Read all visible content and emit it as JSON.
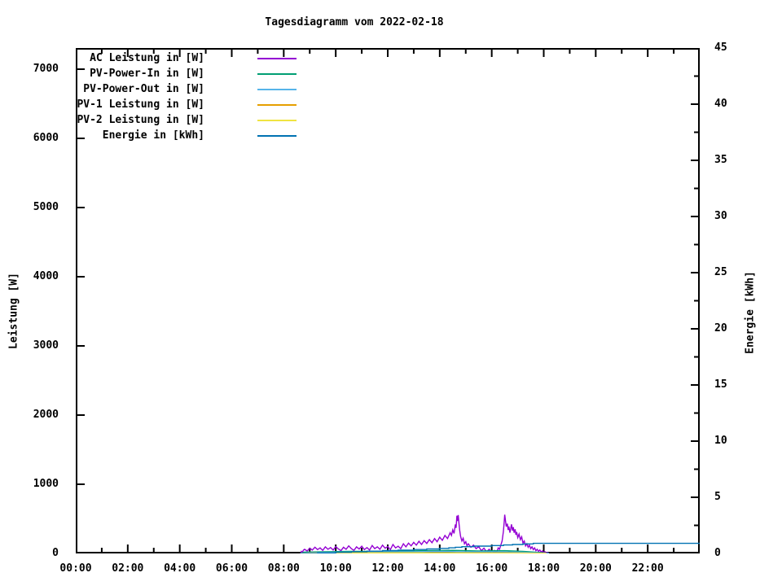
{
  "title": "Tagesdiagramm vom 2022-02-18",
  "colors": {
    "background": "#ffffff",
    "border": "#000000",
    "ac": "#9400d3",
    "pv_in": "#009e73",
    "pv_out": "#56b4e9",
    "pv1": "#e69f00",
    "pv2": "#f0e442",
    "energie": "#0072b2"
  },
  "axes": {
    "left": {
      "label": "Leistung [W]",
      "tick_values": [
        0,
        1000,
        2000,
        3000,
        4000,
        5000,
        6000,
        7000
      ],
      "tick_labels": [
        "0",
        "1000",
        "2000",
        "3000",
        "4000",
        "5000",
        "6000",
        "7000"
      ],
      "pixel_max": 7306
    },
    "right": {
      "label": "Energie [kWh]",
      "range": [
        0,
        45
      ],
      "major_step": 5,
      "minor_step": 2.5,
      "tick_labels": [
        "0",
        "5",
        "10",
        "15",
        "20",
        "25",
        "30",
        "35",
        "40",
        "45"
      ]
    },
    "x": {
      "range_hours": [
        0,
        24
      ],
      "major_step_hours": 2,
      "minor_step_hours": 1,
      "ticks": [
        {
          "h": 0,
          "label": "00:00"
        },
        {
          "h": 2,
          "label": "02:00"
        },
        {
          "h": 4,
          "label": "04:00"
        },
        {
          "h": 6,
          "label": "06:00"
        },
        {
          "h": 8,
          "label": "08:00"
        },
        {
          "h": 10,
          "label": "10:00"
        },
        {
          "h": 12,
          "label": "12:00"
        },
        {
          "h": 14,
          "label": "14:00"
        },
        {
          "h": 16,
          "label": "16:00"
        },
        {
          "h": 18,
          "label": "18:00"
        },
        {
          "h": 20,
          "label": "20:00"
        },
        {
          "h": 22,
          "label": "22:00"
        }
      ]
    }
  },
  "legend": [
    {
      "label": "AC Leistung in [W]",
      "series": "ac"
    },
    {
      "label": "PV-Power-In in [W]",
      "series": "pv_in"
    },
    {
      "label": "PV-Power-Out in [W]",
      "series": "pv_out"
    },
    {
      "label": "PV-1 Leistung in [W]",
      "series": "pv1"
    },
    {
      "label": "PV-2 Leistung in [W]",
      "series": "pv2"
    },
    {
      "label": "Energie in [kWh]",
      "series": "energie"
    }
  ],
  "chart_data": {
    "type": "line",
    "title": "Tagesdiagramm vom 2022-02-18",
    "xlabel": "",
    "ylabel": "Leistung [W]",
    "y2label": "Energie [kWh]",
    "x_unit": "hours",
    "xlim": [
      0,
      24
    ],
    "ylim": [
      0,
      7306
    ],
    "y2lim": [
      0,
      45
    ],
    "grid": false,
    "legend_position": "top-left-inside",
    "series": [
      {
        "name": "AC Leistung in [W]",
        "key": "ac",
        "axis": "y",
        "color": "#9400d3",
        "step": false,
        "points": [
          [
            8.65,
            0
          ],
          [
            8.68,
            30
          ],
          [
            8.72,
            15
          ],
          [
            8.75,
            45
          ],
          [
            8.8,
            60
          ],
          [
            8.9,
            35
          ],
          [
            9.0,
            75
          ],
          [
            9.1,
            50
          ],
          [
            9.2,
            90
          ],
          [
            9.3,
            55
          ],
          [
            9.4,
            80
          ],
          [
            9.5,
            45
          ],
          [
            9.6,
            95
          ],
          [
            9.7,
            60
          ],
          [
            9.8,
            85
          ],
          [
            9.9,
            50
          ],
          [
            10.0,
            100
          ],
          [
            10.1,
            65
          ],
          [
            10.2,
            40
          ],
          [
            10.3,
            90
          ],
          [
            10.4,
            60
          ],
          [
            10.5,
            110
          ],
          [
            10.6,
            70
          ],
          [
            10.7,
            45
          ],
          [
            10.8,
            95
          ],
          [
            10.9,
            65
          ],
          [
            11.0,
            105
          ],
          [
            11.1,
            55
          ],
          [
            11.2,
            85
          ],
          [
            11.3,
            50
          ],
          [
            11.4,
            115
          ],
          [
            11.5,
            70
          ],
          [
            11.6,
            95
          ],
          [
            11.7,
            60
          ],
          [
            11.8,
            120
          ],
          [
            11.9,
            75
          ],
          [
            12.0,
            100
          ],
          [
            12.1,
            55
          ],
          [
            12.2,
            130
          ],
          [
            12.3,
            80
          ],
          [
            12.4,
            105
          ],
          [
            12.5,
            70
          ],
          [
            12.6,
            140
          ],
          [
            12.7,
            95
          ],
          [
            12.8,
            150
          ],
          [
            12.9,
            110
          ],
          [
            13.0,
            160
          ],
          [
            13.1,
            120
          ],
          [
            13.2,
            175
          ],
          [
            13.3,
            130
          ],
          [
            13.4,
            185
          ],
          [
            13.5,
            145
          ],
          [
            13.6,
            200
          ],
          [
            13.7,
            155
          ],
          [
            13.8,
            215
          ],
          [
            13.9,
            170
          ],
          [
            14.0,
            235
          ],
          [
            14.1,
            190
          ],
          [
            14.2,
            260
          ],
          [
            14.3,
            215
          ],
          [
            14.4,
            300
          ],
          [
            14.45,
            260
          ],
          [
            14.5,
            340
          ],
          [
            14.55,
            290
          ],
          [
            14.6,
            420
          ],
          [
            14.63,
            370
          ],
          [
            14.66,
            545
          ],
          [
            14.68,
            470
          ],
          [
            14.71,
            555
          ],
          [
            14.74,
            430
          ],
          [
            14.77,
            330
          ],
          [
            14.8,
            250
          ],
          [
            14.85,
            180
          ],
          [
            14.9,
            220
          ],
          [
            14.95,
            140
          ],
          [
            15.0,
            170
          ],
          [
            15.05,
            110
          ],
          [
            15.1,
            140
          ],
          [
            15.2,
            90
          ],
          [
            15.3,
            120
          ],
          [
            15.4,
            70
          ],
          [
            15.5,
            100
          ],
          [
            15.6,
            40
          ],
          [
            15.7,
            75
          ],
          [
            15.8,
            25
          ],
          [
            15.9,
            60
          ],
          [
            16.0,
            15
          ],
          [
            16.1,
            45
          ],
          [
            16.2,
            25
          ],
          [
            16.25,
            80
          ],
          [
            16.3,
            60
          ],
          [
            16.35,
            120
          ],
          [
            16.4,
            180
          ],
          [
            16.45,
            320
          ],
          [
            16.48,
            460
          ],
          [
            16.5,
            560
          ],
          [
            16.53,
            470
          ],
          [
            16.56,
            390
          ],
          [
            16.6,
            430
          ],
          [
            16.63,
            340
          ],
          [
            16.66,
            390
          ],
          [
            16.7,
            300
          ],
          [
            16.73,
            360
          ],
          [
            16.76,
            420
          ],
          [
            16.8,
            330
          ],
          [
            16.83,
            380
          ],
          [
            16.86,
            300
          ],
          [
            16.9,
            350
          ],
          [
            16.93,
            270
          ],
          [
            16.96,
            310
          ],
          [
            17.0,
            230
          ],
          [
            17.05,
            280
          ],
          [
            17.1,
            200
          ],
          [
            17.15,
            240
          ],
          [
            17.2,
            150
          ],
          [
            17.25,
            180
          ],
          [
            17.3,
            110
          ],
          [
            17.35,
            140
          ],
          [
            17.4,
            90
          ],
          [
            17.45,
            120
          ],
          [
            17.5,
            70
          ],
          [
            17.55,
            95
          ],
          [
            17.6,
            55
          ],
          [
            17.65,
            80
          ],
          [
            17.7,
            40
          ],
          [
            17.75,
            60
          ],
          [
            17.8,
            30
          ],
          [
            17.85,
            50
          ],
          [
            17.9,
            20
          ],
          [
            17.95,
            35
          ],
          [
            18.0,
            15
          ],
          [
            18.05,
            25
          ],
          [
            18.1,
            8
          ],
          [
            18.15,
            12
          ],
          [
            18.2,
            0
          ]
        ]
      },
      {
        "name": "PV-Power-In in [W]",
        "key": "pv_in",
        "axis": "y",
        "color": "#009e73",
        "step": false,
        "points": [
          [
            8.65,
            0
          ],
          [
            8.8,
            20
          ],
          [
            9.5,
            25
          ],
          [
            10.5,
            30
          ],
          [
            11.5,
            30
          ],
          [
            12.5,
            35
          ],
          [
            13.5,
            40
          ],
          [
            14.5,
            45
          ],
          [
            15.5,
            35
          ],
          [
            16.5,
            40
          ],
          [
            17.2,
            30
          ],
          [
            17.8,
            15
          ],
          [
            18.2,
            0
          ]
        ]
      },
      {
        "name": "PV-Power-Out in [W]",
        "key": "pv_out",
        "axis": "y",
        "color": "#56b4e9",
        "step": false,
        "points": [
          [
            8.65,
            0
          ],
          [
            9.0,
            12
          ],
          [
            10.0,
            18
          ],
          [
            11.0,
            20
          ],
          [
            12.0,
            22
          ],
          [
            13.0,
            25
          ],
          [
            14.0,
            30
          ],
          [
            15.0,
            25
          ],
          [
            16.0,
            25
          ],
          [
            17.0,
            20
          ],
          [
            17.8,
            8
          ],
          [
            18.2,
            0
          ]
        ]
      },
      {
        "name": "PV-1 Leistung in [W]",
        "key": "pv1",
        "axis": "y",
        "color": "#e69f00",
        "step": false,
        "points": [
          [
            8.65,
            0
          ],
          [
            9.0,
            6
          ],
          [
            11.0,
            8
          ],
          [
            13.0,
            10
          ],
          [
            15.0,
            8
          ],
          [
            17.0,
            6
          ],
          [
            18.1,
            0
          ]
        ]
      },
      {
        "name": "PV-2 Leistung in [W]",
        "key": "pv2",
        "axis": "y",
        "color": "#f0e442",
        "step": false,
        "points": [
          [
            8.65,
            0
          ],
          [
            9.0,
            4
          ],
          [
            11.0,
            6
          ],
          [
            13.0,
            7
          ],
          [
            15.0,
            6
          ],
          [
            17.0,
            4
          ],
          [
            18.1,
            0
          ]
        ]
      },
      {
        "name": "Energie in [kWh]",
        "key": "energie",
        "axis": "y2",
        "color": "#0072b2",
        "step": true,
        "points": [
          [
            8.65,
            0
          ],
          [
            9.3,
            0.05
          ],
          [
            10.0,
            0.1
          ],
          [
            10.6,
            0.15
          ],
          [
            11.2,
            0.2
          ],
          [
            11.8,
            0.25
          ],
          [
            12.4,
            0.3
          ],
          [
            13.0,
            0.35
          ],
          [
            13.5,
            0.4
          ],
          [
            14.0,
            0.45
          ],
          [
            14.35,
            0.5
          ],
          [
            14.6,
            0.55
          ],
          [
            14.85,
            0.6
          ],
          [
            15.3,
            0.65
          ],
          [
            16.0,
            0.7
          ],
          [
            16.45,
            0.75
          ],
          [
            16.8,
            0.8
          ],
          [
            17.2,
            0.85
          ],
          [
            17.6,
            0.9
          ],
          [
            24.0,
            0.9
          ]
        ]
      }
    ]
  }
}
